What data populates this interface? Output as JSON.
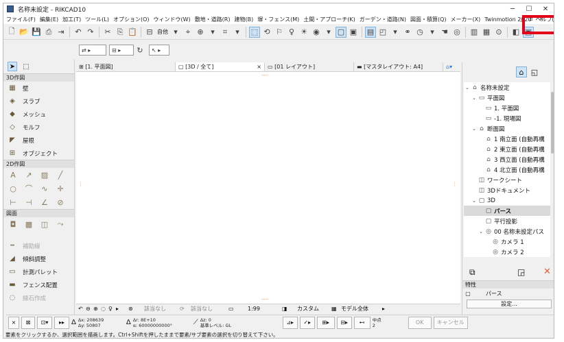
{
  "window": {
    "title": "名称未設定 - RIKCAD10",
    "controls": {
      "minimize": "─",
      "maximize": "☐",
      "close": "✕"
    },
    "mdi_controls": "_ ▫ ×"
  },
  "menu": [
    "ファイル(F)",
    "編集(E)",
    "加工(T)",
    "ツール(L)",
    "オプション(O)",
    "ウィンドウ(W)",
    "敷地・道路(R)",
    "建物(B)",
    "塀・フェンス(M)",
    "土間・アプローチ(K)",
    "ガーデン・道路(N)",
    "図面・積算(Q)",
    "メーカー(X)",
    "Twinmotion 2020",
    "ヘルプ(H)"
  ],
  "toolbar": {
    "view_label": "自他"
  },
  "palette": {
    "section_3d": "3D作図",
    "tools_3d": [
      {
        "icon": "wall-icon",
        "glyph": "▦",
        "label": "壁"
      },
      {
        "icon": "slab-icon",
        "glyph": "◈",
        "label": "スラブ"
      },
      {
        "icon": "mesh-icon",
        "glyph": "◆",
        "label": "メッシュ"
      },
      {
        "icon": "morph-icon",
        "glyph": "◇",
        "label": "モルフ"
      },
      {
        "icon": "roof-icon",
        "glyph": "◤",
        "label": "屋根"
      },
      {
        "icon": "object-icon",
        "glyph": "⊞",
        "label": "オブジェクト"
      }
    ],
    "section_2d": "2D作図",
    "section_view": "図面",
    "extra_tools": [
      {
        "icon": "guide-line-icon",
        "glyph": "┅",
        "label": "補助線",
        "dim": true
      },
      {
        "icon": "slope-adjust-icon",
        "glyph": "◢",
        "label": "傾斜調整",
        "dim": false
      },
      {
        "icon": "measure-palette-icon",
        "glyph": "▭",
        "label": "計測パレット",
        "dim": false
      },
      {
        "icon": "fence-placement-icon",
        "glyph": "▬",
        "label": "フェンス配置",
        "dim": false
      },
      {
        "icon": "curb-create-icon",
        "glyph": "◌",
        "label": "縁石作成",
        "dim": true
      }
    ]
  },
  "tabs": [
    {
      "label": "[1. 平面図]",
      "icon": "⊞"
    },
    {
      "label": "[3D / 全て]",
      "icon": "▢",
      "active": true,
      "close": "×"
    },
    {
      "label": "[01 レイアウト]",
      "icon": "▭"
    },
    {
      "label": "[マスタレイアウト: A4]",
      "icon": "▬"
    }
  ],
  "navbar": {
    "filter1": "該当なし",
    "filter2": "該当なし",
    "scale": "1:99",
    "layer": "カスタム",
    "model": "モデル全体"
  },
  "infobox": {
    "dx": "Δx: 208639",
    "dy": "Δy: 50807",
    "dr": "Δr: 8E+10",
    "da": "α: 60000000000°",
    "dz": "Δz: 0",
    "level": "基準レベル: GL",
    "center": "中点",
    "center_val": "2",
    "ok": "OK",
    "cancel": "キャンセル"
  },
  "status": "要素をクリックするか、選択範囲を描画します。Ctrl+Shiftを押したままで要素/サブ要素の選択を切り替えて下さい。",
  "navigator": {
    "items": [
      {
        "level": 0,
        "tw": "⌄",
        "icon": "⌂",
        "label": "名称未設定"
      },
      {
        "level": 1,
        "tw": "⌄",
        "icon": "▭",
        "label": "平面図"
      },
      {
        "level": 2,
        "tw": "",
        "icon": "▭",
        "label": "1. 平面図"
      },
      {
        "level": 2,
        "tw": "",
        "icon": "▭",
        "label": "-1. 現場図"
      },
      {
        "level": 1,
        "tw": "⌄",
        "icon": "⌂",
        "label": "断面図"
      },
      {
        "level": 2,
        "tw": "",
        "icon": "⌂",
        "label": "1 南立面 (自動再構"
      },
      {
        "level": 2,
        "tw": "",
        "icon": "⌂",
        "label": "2 東立面 (自動再構"
      },
      {
        "level": 2,
        "tw": "",
        "icon": "⌂",
        "label": "3 西立面 (自動再構"
      },
      {
        "level": 2,
        "tw": "",
        "icon": "⌂",
        "label": "4 北立面 (自動再構"
      },
      {
        "level": 1,
        "tw": "",
        "icon": "◫",
        "label": "ワークシート"
      },
      {
        "level": 1,
        "tw": "",
        "icon": "◫",
        "label": "3Dドキュメント"
      },
      {
        "level": 1,
        "tw": "⌄",
        "icon": "▢",
        "label": "3D"
      },
      {
        "level": 2,
        "tw": "",
        "icon": "▢",
        "label": "パース",
        "selected": true
      },
      {
        "level": 2,
        "tw": "",
        "icon": "▢",
        "label": "平行投影"
      },
      {
        "level": 2,
        "tw": "⌄",
        "icon": "◎",
        "label": "00 名称未設定パス"
      },
      {
        "level": 3,
        "tw": "",
        "icon": "◎",
        "label": "カメラ 1"
      },
      {
        "level": 3,
        "tw": "",
        "icon": "◎",
        "label": "カメラ 2"
      }
    ]
  },
  "properties": {
    "title": "特性",
    "value": "パース",
    "settings": "設定..."
  },
  "colors": {
    "highlight": "#e4001a",
    "active_tool": "#cfe3f7",
    "grip": "#e28c2c"
  }
}
